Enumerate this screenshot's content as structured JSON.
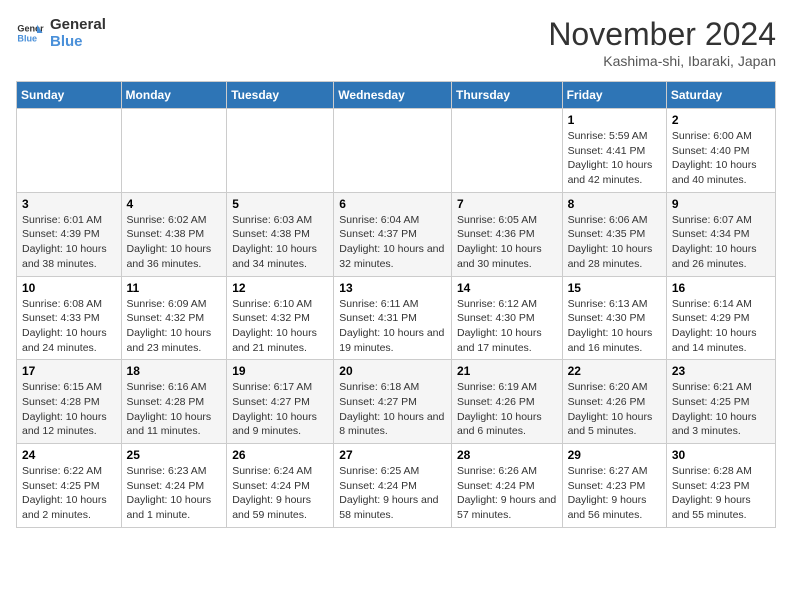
{
  "logo": {
    "line1": "General",
    "line2": "Blue"
  },
  "title": "November 2024",
  "subtitle": "Kashima-shi, Ibaraki, Japan",
  "days_of_week": [
    "Sunday",
    "Monday",
    "Tuesday",
    "Wednesday",
    "Thursday",
    "Friday",
    "Saturday"
  ],
  "weeks": [
    [
      {
        "day": "",
        "info": ""
      },
      {
        "day": "",
        "info": ""
      },
      {
        "day": "",
        "info": ""
      },
      {
        "day": "",
        "info": ""
      },
      {
        "day": "",
        "info": ""
      },
      {
        "day": "1",
        "info": "Sunrise: 5:59 AM\nSunset: 4:41 PM\nDaylight: 10 hours and 42 minutes."
      },
      {
        "day": "2",
        "info": "Sunrise: 6:00 AM\nSunset: 4:40 PM\nDaylight: 10 hours and 40 minutes."
      }
    ],
    [
      {
        "day": "3",
        "info": "Sunrise: 6:01 AM\nSunset: 4:39 PM\nDaylight: 10 hours and 38 minutes."
      },
      {
        "day": "4",
        "info": "Sunrise: 6:02 AM\nSunset: 4:38 PM\nDaylight: 10 hours and 36 minutes."
      },
      {
        "day": "5",
        "info": "Sunrise: 6:03 AM\nSunset: 4:38 PM\nDaylight: 10 hours and 34 minutes."
      },
      {
        "day": "6",
        "info": "Sunrise: 6:04 AM\nSunset: 4:37 PM\nDaylight: 10 hours and 32 minutes."
      },
      {
        "day": "7",
        "info": "Sunrise: 6:05 AM\nSunset: 4:36 PM\nDaylight: 10 hours and 30 minutes."
      },
      {
        "day": "8",
        "info": "Sunrise: 6:06 AM\nSunset: 4:35 PM\nDaylight: 10 hours and 28 minutes."
      },
      {
        "day": "9",
        "info": "Sunrise: 6:07 AM\nSunset: 4:34 PM\nDaylight: 10 hours and 26 minutes."
      }
    ],
    [
      {
        "day": "10",
        "info": "Sunrise: 6:08 AM\nSunset: 4:33 PM\nDaylight: 10 hours and 24 minutes."
      },
      {
        "day": "11",
        "info": "Sunrise: 6:09 AM\nSunset: 4:32 PM\nDaylight: 10 hours and 23 minutes."
      },
      {
        "day": "12",
        "info": "Sunrise: 6:10 AM\nSunset: 4:32 PM\nDaylight: 10 hours and 21 minutes."
      },
      {
        "day": "13",
        "info": "Sunrise: 6:11 AM\nSunset: 4:31 PM\nDaylight: 10 hours and 19 minutes."
      },
      {
        "day": "14",
        "info": "Sunrise: 6:12 AM\nSunset: 4:30 PM\nDaylight: 10 hours and 17 minutes."
      },
      {
        "day": "15",
        "info": "Sunrise: 6:13 AM\nSunset: 4:30 PM\nDaylight: 10 hours and 16 minutes."
      },
      {
        "day": "16",
        "info": "Sunrise: 6:14 AM\nSunset: 4:29 PM\nDaylight: 10 hours and 14 minutes."
      }
    ],
    [
      {
        "day": "17",
        "info": "Sunrise: 6:15 AM\nSunset: 4:28 PM\nDaylight: 10 hours and 12 minutes."
      },
      {
        "day": "18",
        "info": "Sunrise: 6:16 AM\nSunset: 4:28 PM\nDaylight: 10 hours and 11 minutes."
      },
      {
        "day": "19",
        "info": "Sunrise: 6:17 AM\nSunset: 4:27 PM\nDaylight: 10 hours and 9 minutes."
      },
      {
        "day": "20",
        "info": "Sunrise: 6:18 AM\nSunset: 4:27 PM\nDaylight: 10 hours and 8 minutes."
      },
      {
        "day": "21",
        "info": "Sunrise: 6:19 AM\nSunset: 4:26 PM\nDaylight: 10 hours and 6 minutes."
      },
      {
        "day": "22",
        "info": "Sunrise: 6:20 AM\nSunset: 4:26 PM\nDaylight: 10 hours and 5 minutes."
      },
      {
        "day": "23",
        "info": "Sunrise: 6:21 AM\nSunset: 4:25 PM\nDaylight: 10 hours and 3 minutes."
      }
    ],
    [
      {
        "day": "24",
        "info": "Sunrise: 6:22 AM\nSunset: 4:25 PM\nDaylight: 10 hours and 2 minutes."
      },
      {
        "day": "25",
        "info": "Sunrise: 6:23 AM\nSunset: 4:24 PM\nDaylight: 10 hours and 1 minute."
      },
      {
        "day": "26",
        "info": "Sunrise: 6:24 AM\nSunset: 4:24 PM\nDaylight: 9 hours and 59 minutes."
      },
      {
        "day": "27",
        "info": "Sunrise: 6:25 AM\nSunset: 4:24 PM\nDaylight: 9 hours and 58 minutes."
      },
      {
        "day": "28",
        "info": "Sunrise: 6:26 AM\nSunset: 4:24 PM\nDaylight: 9 hours and 57 minutes."
      },
      {
        "day": "29",
        "info": "Sunrise: 6:27 AM\nSunset: 4:23 PM\nDaylight: 9 hours and 56 minutes."
      },
      {
        "day": "30",
        "info": "Sunrise: 6:28 AM\nSunset: 4:23 PM\nDaylight: 9 hours and 55 minutes."
      }
    ]
  ]
}
